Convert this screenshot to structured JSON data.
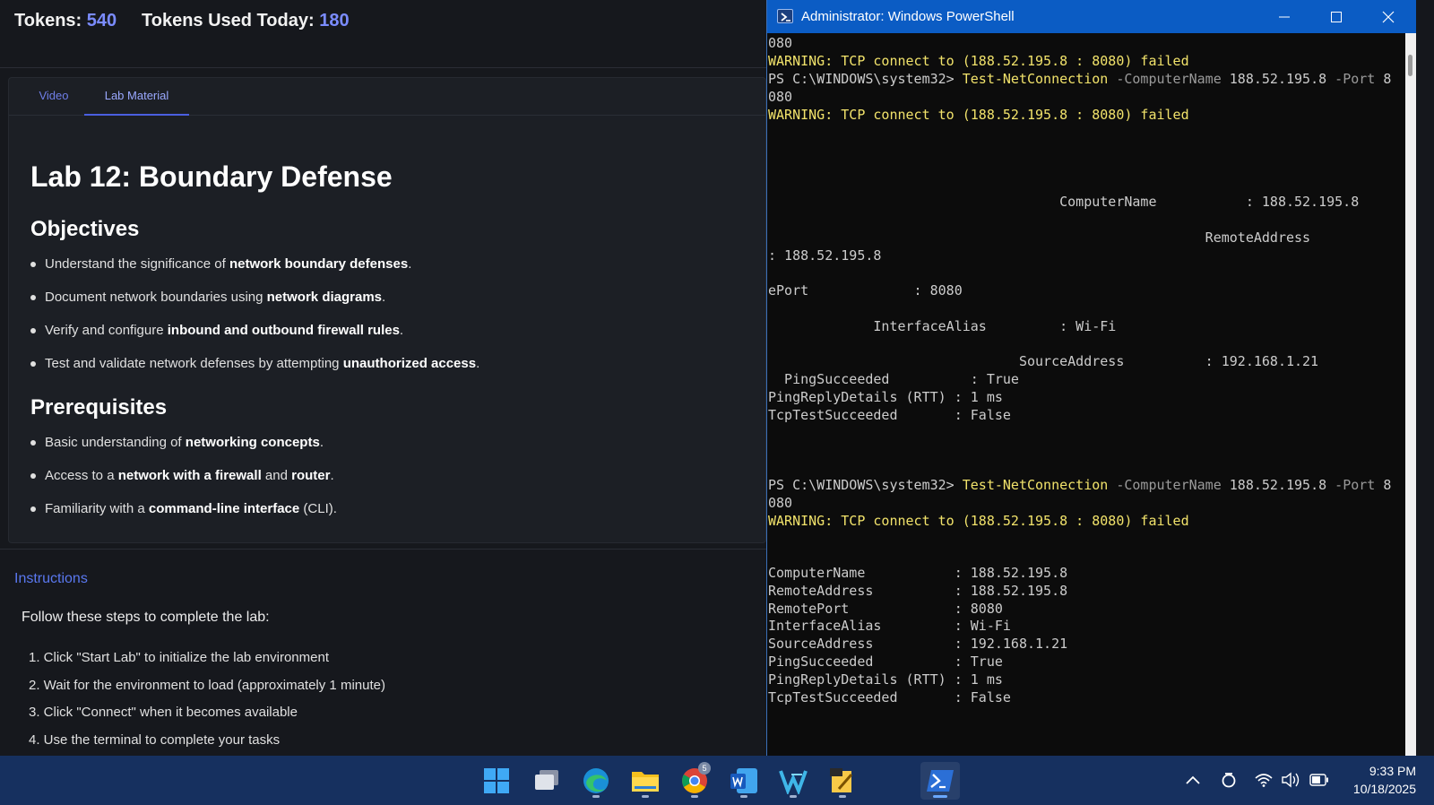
{
  "tokens": {
    "label": "Tokens:",
    "value": "540",
    "used_label": "Tokens Used Today:",
    "used_value": "180"
  },
  "tabs": {
    "video": "Video",
    "lab_material": "Lab Material"
  },
  "lab": {
    "title": "Lab 12: Boundary Defense",
    "objectives_heading": "Objectives",
    "objectives": [
      {
        "pre": "Understand the significance of ",
        "bold": "network boundary defenses",
        "post": "."
      },
      {
        "pre": "Document network boundaries using ",
        "bold": "network diagrams",
        "post": "."
      },
      {
        "pre": "Verify and configure ",
        "bold": "inbound and outbound firewall rules",
        "post": "."
      },
      {
        "pre": "Test and validate network defenses by attempting ",
        "bold": "unauthorized access",
        "post": "."
      }
    ],
    "prerequisites_heading": "Prerequisites",
    "prerequisites": [
      {
        "pre": "Basic understanding of ",
        "bold": "networking concepts",
        "mid": "",
        "bold2": "",
        "post": "."
      },
      {
        "pre": "Access to a ",
        "bold": "network with a firewall",
        "mid": " and ",
        "bold2": "router",
        "post": "."
      },
      {
        "pre": "Familiarity with a ",
        "bold": "command-line interface",
        "mid": "",
        "bold2": "",
        "post": " (CLI)."
      }
    ]
  },
  "instructions": {
    "heading": "Instructions",
    "intro": "Follow these steps to complete the lab:",
    "steps": [
      "1. Click \"Start Lab\" to initialize the lab environment",
      "2. Wait for the environment to load (approximately 1 minute)",
      "3. Click \"Connect\" when it becomes available",
      "4. Use the terminal to complete your tasks"
    ]
  },
  "powershell": {
    "title": "Administrator: Windows PowerShell",
    "prompt": "PS C:\\WINDOWS\\system32> ",
    "cmdlet": "Test-NetConnection",
    "param_computer": " -ComputerName ",
    "computer_value": "188.52.195.8",
    "param_port": " -Port ",
    "port_first_char": "8",
    "port_wrap": "080",
    "warning": "WARNING: TCP connect to (188.52.195.8 : 8080) failed",
    "wrapped_output": [
      "                                    ComputerName           : 188.52.195.8",
      "",
      "                                                      RemoteAddress",
      ": 188.52.195.8",
      "                                                                                Remot",
      "ePort             : 8080",
      "",
      "             InterfaceAlias         : Wi-Fi",
      "",
      "                               SourceAddress          : 192.168.1.21",
      "  PingSucceeded          : True",
      "PingReplyDetails (RTT) : 1 ms",
      "TcpTestSucceeded       : False"
    ],
    "output": [
      "ComputerName           : 188.52.195.8",
      "RemoteAddress          : 188.52.195.8",
      "RemotePort             : 8080",
      "InterfaceAlias         : Wi-Fi",
      "SourceAddress          : 192.168.1.21",
      "PingSucceeded          : True",
      "PingReplyDetails (RTT) : 1 ms",
      "TcpTestSucceeded       : False"
    ]
  },
  "taskbar": {
    "apps": [
      "start-icon",
      "task-view-icon",
      "edge-icon",
      "file-explorer-icon",
      "chrome-icon",
      "word-icon",
      "visual-studio-icon",
      "sticky-notes-icon",
      "powershell-icon"
    ],
    "chrome_badge": "5",
    "time": "9:33 PM",
    "date": "10/18/2025"
  }
}
